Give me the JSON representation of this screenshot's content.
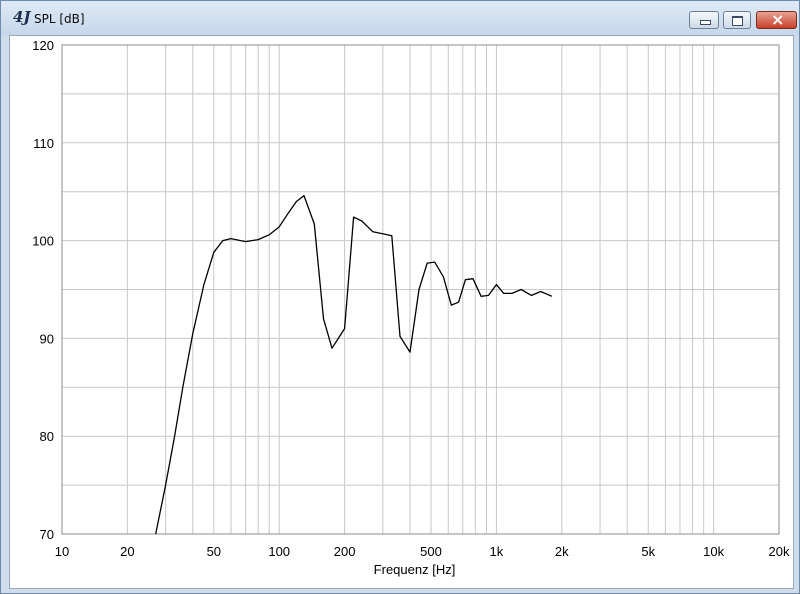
{
  "window": {
    "logo": "4J",
    "title": "SPL [dB]",
    "icons": [
      "minimize-icon",
      "maximize-icon",
      "close-icon"
    ]
  },
  "chart_data": {
    "type": "line",
    "title": "SPL [dB]",
    "xlabel": "Frequenz [Hz]",
    "ylabel": "",
    "xscale": "log",
    "xlim": [
      10,
      20000
    ],
    "ylim": [
      70,
      120
    ],
    "grid": true,
    "x_tick_labels": [
      {
        "v": 10,
        "t": "10"
      },
      {
        "v": 20,
        "t": "20"
      },
      {
        "v": 50,
        "t": "50"
      },
      {
        "v": 100,
        "t": "100"
      },
      {
        "v": 200,
        "t": "200"
      },
      {
        "v": 500,
        "t": "500"
      },
      {
        "v": 1000,
        "t": "1k"
      },
      {
        "v": 2000,
        "t": "2k"
      },
      {
        "v": 5000,
        "t": "5k"
      },
      {
        "v": 10000,
        "t": "10k"
      },
      {
        "v": 20000,
        "t": "20k"
      }
    ],
    "y_ticks": [
      70,
      80,
      90,
      100,
      110,
      120
    ],
    "series": [
      {
        "color": "#000000",
        "x": [
          27,
          30,
          33,
          36,
          40,
          45,
          50,
          55,
          60,
          70,
          80,
          90,
          100,
          110,
          120,
          130,
          145,
          160,
          175,
          200,
          220,
          240,
          270,
          300,
          330,
          360,
          400,
          440,
          480,
          520,
          570,
          620,
          670,
          720,
          780,
          850,
          920,
          1000,
          1080,
          1180,
          1300,
          1450,
          1600,
          1800
        ],
        "y": [
          70,
          75,
          80,
          85,
          90.5,
          95.5,
          98.8,
          100,
          100.2,
          99.9,
          100.1,
          100.6,
          101.4,
          102.8,
          104,
          104.6,
          101.7,
          92,
          89,
          91,
          102.4,
          102,
          100.9,
          100.7,
          100.5,
          90.2,
          88.6,
          95,
          97.7,
          97.8,
          96.3,
          93.4,
          93.7,
          96,
          96.1,
          94.3,
          94.4,
          95.5,
          94.6,
          94.6,
          95,
          94.4,
          94.8,
          94.3
        ]
      }
    ]
  }
}
